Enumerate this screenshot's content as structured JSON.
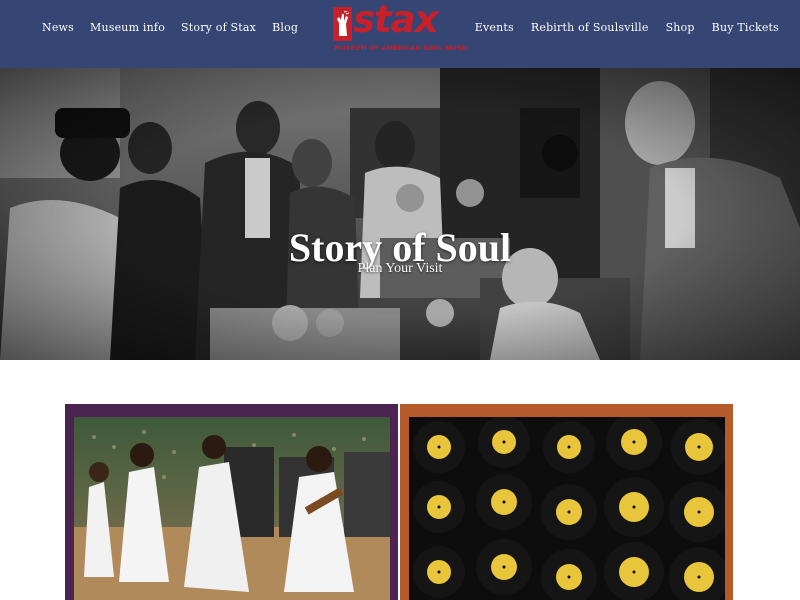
{
  "header": {
    "nav_left": [
      "News",
      "Museum info",
      "Story of Stax",
      "Blog"
    ],
    "nav_right": [
      "Events",
      "Rebirth of Soulsville",
      "Shop",
      "Buy Tickets"
    ],
    "logo": {
      "word": "stax",
      "tagline": "MUSEUM OF AMERICAN SOUL MUSIC",
      "color": "#c8202b"
    },
    "background": "#354574"
  },
  "hero": {
    "title": "Story of Soul",
    "link": "Plan Your Visit"
  },
  "cards": [
    {
      "image": "performers-on-stage-photo",
      "frame_color": "#4a2350"
    },
    {
      "image": "vinyl-records-wall-photo",
      "frame_color": "#b55a2a"
    }
  ]
}
